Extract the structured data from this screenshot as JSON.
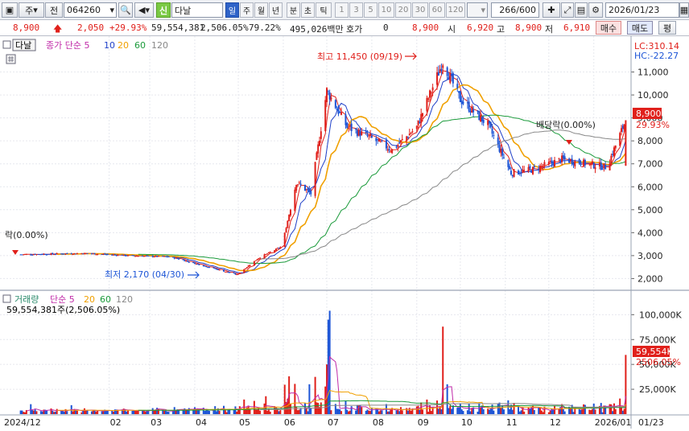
{
  "toolbar": {
    "market": "주",
    "type": "전",
    "code": "064260",
    "name_badge": "신",
    "name": "다날",
    "periods": [
      "일",
      "주",
      "월",
      "년",
      "분",
      "초",
      "틱"
    ],
    "minutes": [
      "1",
      "3",
      "5",
      "10",
      "20",
      "30",
      "60",
      "120"
    ],
    "count": "266/600",
    "date": "2026/01/23",
    "accent": "#2f63c8"
  },
  "quote": {
    "price": "8,900",
    "change": "2,050",
    "change_pct": "+29.93%",
    "volume": "59,554,381",
    "volume_pct": "2,506.05%",
    "turnover": "79.22%",
    "amount": "495,026백만",
    "hoga_label": "호가",
    "hoga": "0",
    "hoga_price": "8,900",
    "open_label": "시",
    "open": "6,920",
    "high_label": "고",
    "high": "8,900",
    "low_label": "저",
    "low": "6,910",
    "buy": "매수",
    "sell": "매도",
    "eval": "평"
  },
  "price_pane": {
    "legend_name": "다날",
    "legend_rest": "종가 단순 5",
    "ma_periods": [
      "10",
      "20",
      "60",
      "120"
    ],
    "ma_colors": [
      "#e0201b",
      "#1e3fc8",
      "#f0a000",
      "#1a9a3a",
      "#888888"
    ],
    "lc": "LC:310.14",
    "hc": "HC:-22.27",
    "max_label": "최고 11,450 (09/19)",
    "min_label": "최저 2,170 (04/30)",
    "div_label": "배당락(0.00%)",
    "div_label_left": "락(0.00%)",
    "price_tag": "8,900",
    "pct_tag": "29.93%"
  },
  "volume_pane": {
    "legend_name": "거래량",
    "legend_rest": "단순 5",
    "ma_periods": [
      "20",
      "60",
      "120"
    ],
    "current": "59,554,381주(2,506.05%)",
    "vol_tag": "59,554K",
    "vol_pct_tag": "2506.05%"
  },
  "chart_data": {
    "type": "candlestick",
    "price_axis": [
      "11,000",
      "10,000",
      "9,000",
      "8,000",
      "7,000",
      "6,000",
      "5,000",
      "4,000",
      "3,000",
      "2,000"
    ],
    "price_ylim": [
      1700,
      12000
    ],
    "volume_axis": [
      "100,000K",
      "75,000K",
      "50,000K",
      "25,000K"
    ],
    "volume_ylim": [
      0,
      110000
    ],
    "x_labels": [
      "2024/12",
      "02",
      "03",
      "04",
      "05",
      "06",
      "07",
      "08",
      "09",
      "10",
      "11",
      "12",
      "2026/01",
      "01/23"
    ],
    "close_path": [
      [
        "2024-12-01",
        3050
      ],
      [
        "2025-01-15",
        3100
      ],
      [
        "2025-02-15",
        3000
      ],
      [
        "2025-03-15",
        2950
      ],
      [
        "2025-04-30",
        2170
      ],
      [
        "2025-05-15",
        2900
      ],
      [
        "2025-05-31",
        3400
      ],
      [
        "2025-06-10",
        6200
      ],
      [
        "2025-06-20",
        5700
      ],
      [
        "2025-07-01",
        10200
      ],
      [
        "2025-07-15",
        8600
      ],
      [
        "2025-08-01",
        8100
      ],
      [
        "2025-08-15",
        7600
      ],
      [
        "2025-09-01",
        8600
      ],
      [
        "2025-09-19",
        11450
      ],
      [
        "2025-10-01",
        9800
      ],
      [
        "2025-10-20",
        8700
      ],
      [
        "2025-11-05",
        6600
      ],
      [
        "2025-11-20",
        6750
      ],
      [
        "2025-12-10",
        7200
      ],
      [
        "2026-01-10",
        6850
      ],
      [
        "2026-01-23",
        8900
      ]
    ]
  }
}
